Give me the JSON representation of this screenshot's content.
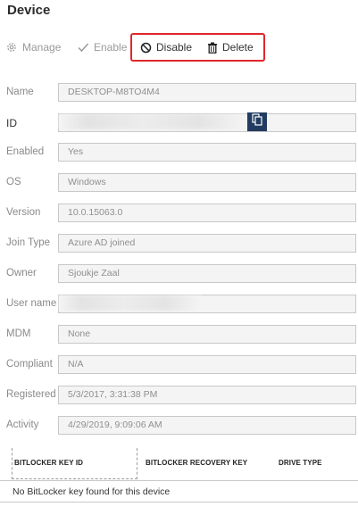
{
  "page": {
    "title": "Device"
  },
  "toolbar": {
    "manage": "Manage",
    "enable": "Enable",
    "disable": "Disable",
    "delete": "Delete"
  },
  "fields": [
    {
      "label": "Name",
      "value": "DESKTOP-M8TO4M4"
    },
    {
      "label": "ID",
      "value": ""
    },
    {
      "label": "Enabled",
      "value": "Yes"
    },
    {
      "label": "OS",
      "value": "Windows"
    },
    {
      "label": "Version",
      "value": "10.0.15063.0"
    },
    {
      "label": "Join Type",
      "value": "Azure AD joined"
    },
    {
      "label": "Owner",
      "value": "Sjoukje Zaal"
    },
    {
      "label": "User name",
      "value": ""
    },
    {
      "label": "MDM",
      "value": "None"
    },
    {
      "label": "Compliant",
      "value": "N/A"
    },
    {
      "label": "Registered",
      "value": "5/3/2017, 3:31:38 PM"
    },
    {
      "label": "Activity",
      "value": "4/29/2019, 9:09:06 AM"
    }
  ],
  "bitlocker_table": {
    "columns": [
      "BITLOCKER KEY ID",
      "BITLOCKER RECOVERY KEY",
      "DRIVE TYPE"
    ],
    "empty_message": "No BitLocker key found for this device"
  },
  "colors": {
    "highlight": "#e0272c",
    "copy_button": "#223c61"
  },
  "icons": {
    "manage": "gear-icon",
    "enable": "checkmark-icon",
    "disable": "block-icon",
    "delete": "trash-icon",
    "copy": "copy-icon"
  }
}
